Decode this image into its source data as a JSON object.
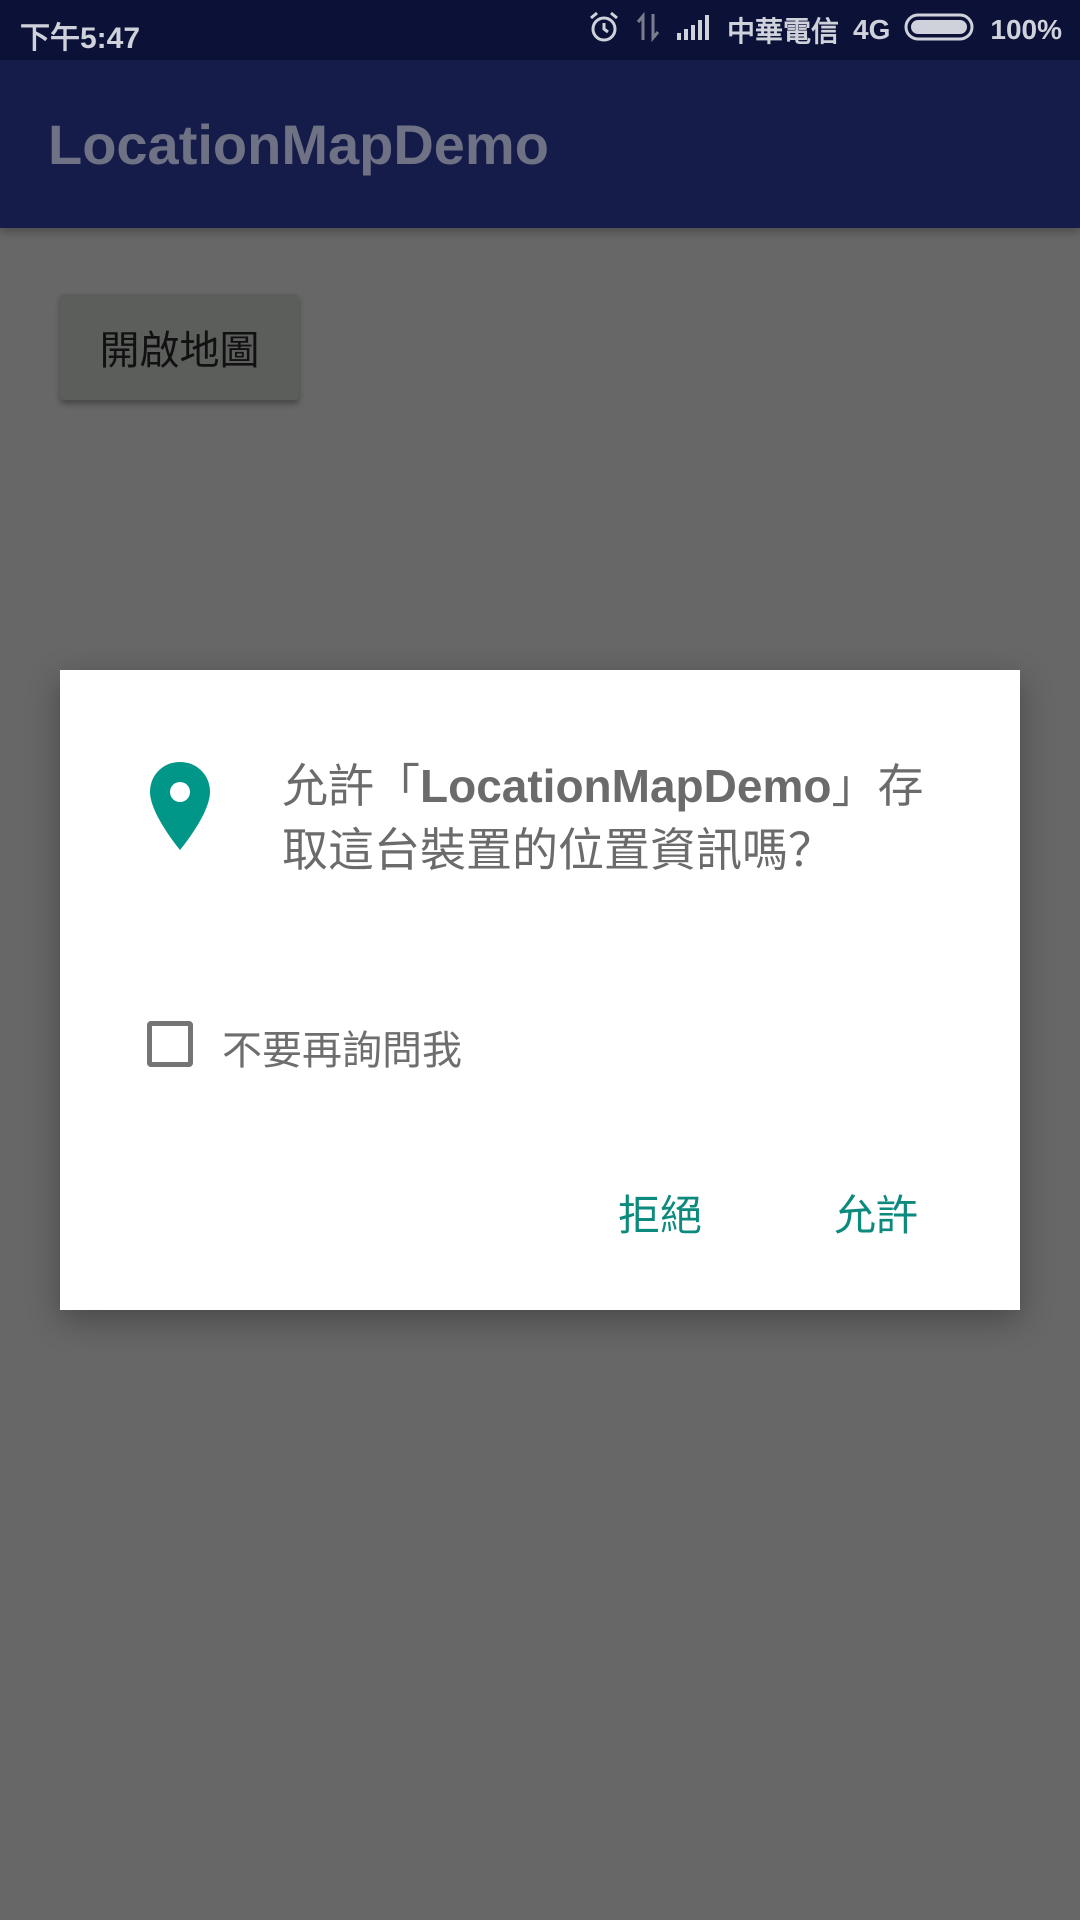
{
  "status_bar": {
    "time": "下午5:47",
    "carrier": "中華電信",
    "network": "4G",
    "battery": "100%",
    "icons": [
      "alarm-icon",
      "data-transfer-icon",
      "signal-icon",
      "battery-icon"
    ]
  },
  "app_bar": {
    "title": "LocationMapDemo"
  },
  "main": {
    "open_map_button": "開啟地圖"
  },
  "dialog": {
    "icon": "location-pin-icon",
    "accent_color": "#009688",
    "message_prefix": "允許「",
    "app_name": "LocationMapDemo",
    "message_suffix": "」存取這台裝置的位置資訊嗎？",
    "dont_ask_again": "不要再詢問我",
    "dont_ask_again_checked": false,
    "deny_button": "拒絕",
    "allow_button": "允許"
  }
}
